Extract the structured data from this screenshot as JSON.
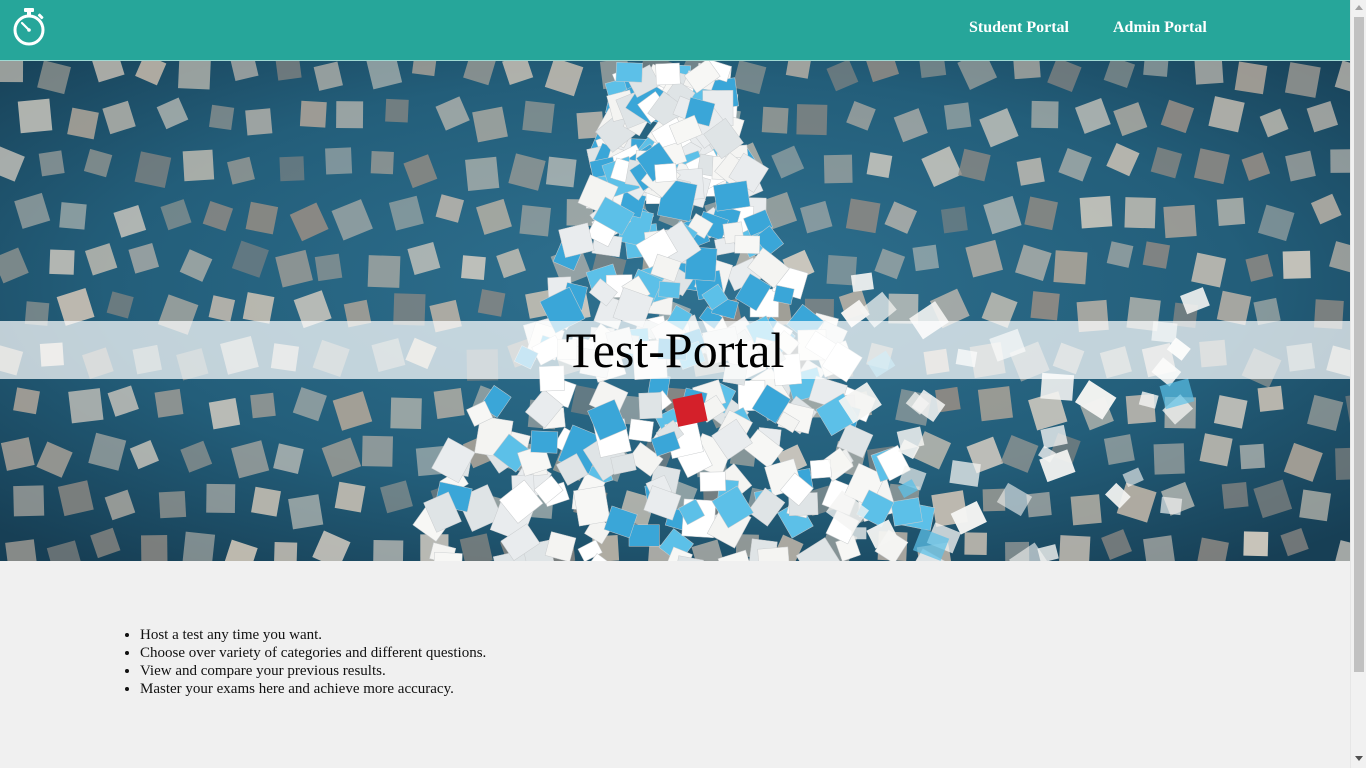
{
  "nav": {
    "logo_icon": "stopwatch-icon",
    "links": [
      {
        "label": "Student Portal"
      },
      {
        "label": "Admin Portal"
      }
    ]
  },
  "hero": {
    "title": "Test-Portal",
    "image": "sticky-notes-figure-image"
  },
  "features": [
    "Host a test any time you want.",
    "Choose over variety of categories and different questions.",
    "View and compare your previous results.",
    "Master your exams here and achieve more accuracy."
  ],
  "colors": {
    "navbar": "#26a69a",
    "background": "#f0f0f0"
  }
}
